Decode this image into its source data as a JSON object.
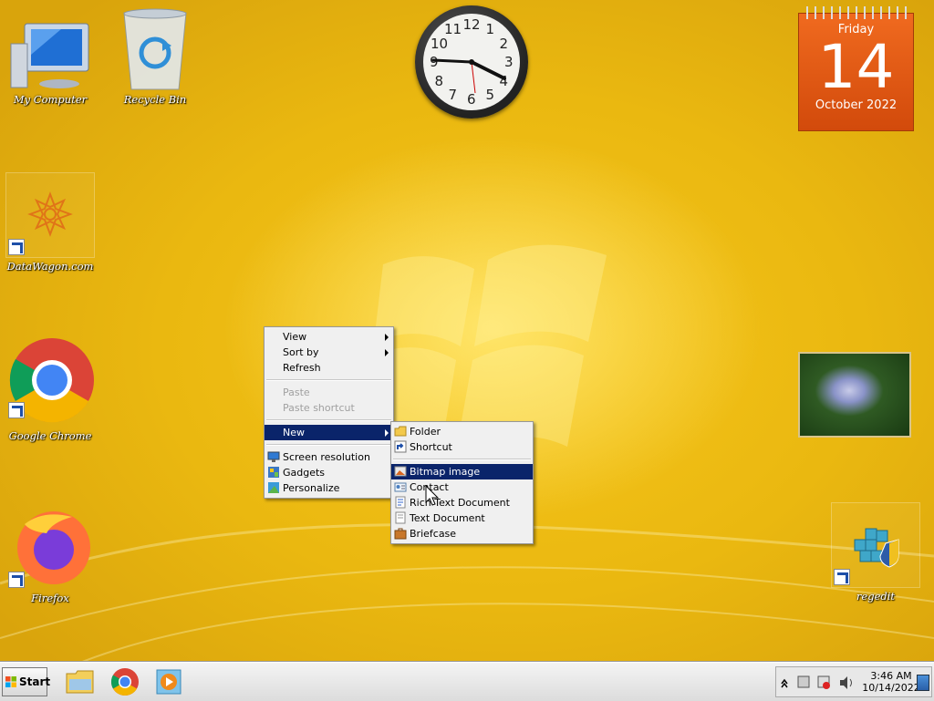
{
  "desktop": {
    "icons": [
      {
        "label": "My Computer"
      },
      {
        "label": "Recycle Bin"
      },
      {
        "label": "DataWagon.com"
      },
      {
        "label": "Google Chrome"
      },
      {
        "label": "Firefox"
      },
      {
        "label": "regedit"
      }
    ]
  },
  "clock": {
    "numbers": [
      "12",
      "1",
      "2",
      "3",
      "4",
      "5",
      "6",
      "7",
      "8",
      "9",
      "10",
      "11"
    ]
  },
  "calendar": {
    "day": "Friday",
    "date": "14",
    "month": "October 2022"
  },
  "context_menu": {
    "items": [
      {
        "label": "View"
      },
      {
        "label": "Sort by"
      },
      {
        "label": "Refresh"
      },
      {
        "label": "Paste"
      },
      {
        "label": "Paste shortcut"
      },
      {
        "label": "New"
      },
      {
        "label": "Screen resolution"
      },
      {
        "label": "Gadgets"
      },
      {
        "label": "Personalize"
      }
    ]
  },
  "new_submenu": {
    "items": [
      {
        "label": "Folder"
      },
      {
        "label": "Shortcut"
      },
      {
        "label": "Bitmap image"
      },
      {
        "label": "Contact"
      },
      {
        "label": "Rich Text Document"
      },
      {
        "label": "Text Document"
      },
      {
        "label": "Briefcase"
      }
    ]
  },
  "taskbar": {
    "start_label": "Start",
    "time": "3:46 AM",
    "date": "10/14/2022"
  },
  "colors": {
    "menu_highlight": "#0a246a",
    "calendar_orange": "#e25a14"
  }
}
